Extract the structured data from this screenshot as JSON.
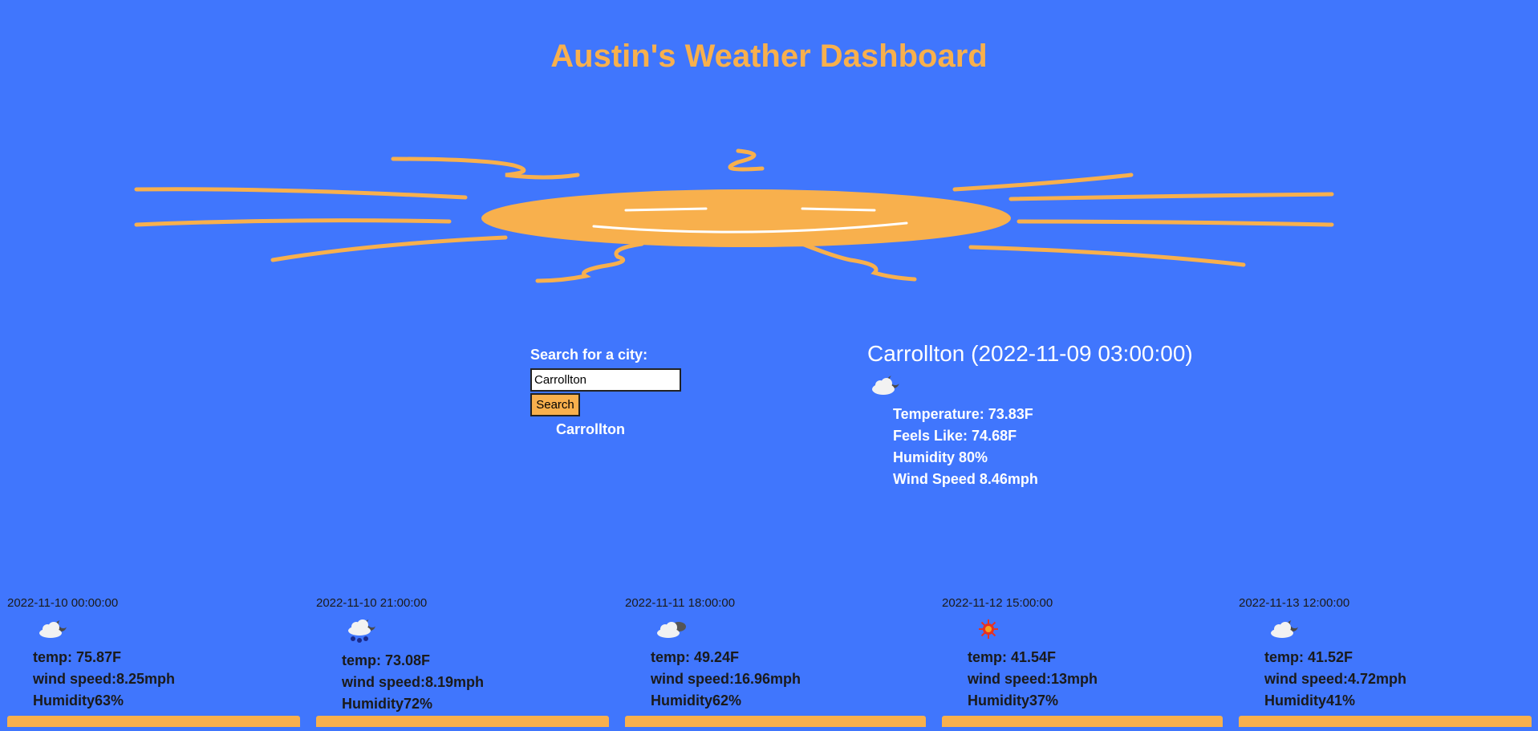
{
  "header": {
    "title": "Austin's Weather Dashboard"
  },
  "search": {
    "label": "Search for a city:",
    "input_value": "Carrollton",
    "button_label": "Search",
    "history": [
      "Carrollton"
    ]
  },
  "current": {
    "heading": "Carrollton (2022-11-09 03:00:00)",
    "icon": "partly-cloudy-night-icon",
    "temperature": "Temperature: 73.83F",
    "feels_like": "Feels Like: 74.68F",
    "humidity": "Humidity 80%",
    "wind_speed": "Wind Speed 8.46mph"
  },
  "forecast": [
    {
      "date": "2022-11-10 00:00:00",
      "icon": "partly-cloudy-night-icon",
      "temp": "temp: 75.87F",
      "wind": "wind speed:8.25mph",
      "humidity": "Humidity63%"
    },
    {
      "date": "2022-11-10 21:00:00",
      "icon": "rain-night-icon",
      "temp": "temp: 73.08F",
      "wind": "wind speed:8.19mph",
      "humidity": "Humidity72%"
    },
    {
      "date": "2022-11-11 18:00:00",
      "icon": "cloudy-icon",
      "temp": "temp: 49.24F",
      "wind": "wind speed:16.96mph",
      "humidity": "Humidity62%"
    },
    {
      "date": "2022-11-12 15:00:00",
      "icon": "sun-icon",
      "temp": "temp: 41.54F",
      "wind": "wind speed:13mph",
      "humidity": "Humidity37%"
    },
    {
      "date": "2022-11-13 12:00:00",
      "icon": "partly-cloudy-night-icon",
      "temp": "temp: 41.52F",
      "wind": "wind speed:4.72mph",
      "humidity": "Humidity41%"
    }
  ],
  "colors": {
    "background": "#4076fd",
    "accent": "#f8b04d",
    "text_light": "#ffffff",
    "text_dark": "#1a1a1a"
  }
}
